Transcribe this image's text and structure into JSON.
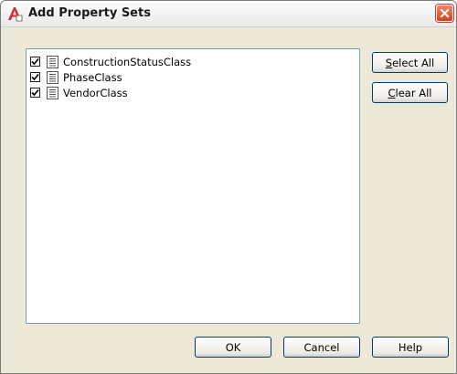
{
  "window": {
    "title": "Add Property Sets"
  },
  "icons": {
    "app": "autocad-a-icon",
    "close": "close-icon",
    "item": "property-set-icon",
    "check": "checkmark-icon"
  },
  "colors": {
    "close_red": "#d4401e",
    "list_border": "#7f9db9",
    "dialog_bg": "#ece9d8"
  },
  "list": {
    "items": [
      {
        "label": "ConstructionStatusClass",
        "checked": true
      },
      {
        "label": "PhaseClass",
        "checked": true
      },
      {
        "label": "VendorClass",
        "checked": true
      }
    ]
  },
  "buttons": {
    "select_all": {
      "accel": "S",
      "rest": "elect All"
    },
    "clear_all": {
      "accel": "C",
      "rest": "lear All"
    },
    "ok": "OK",
    "cancel": "Cancel",
    "help": "Help"
  }
}
